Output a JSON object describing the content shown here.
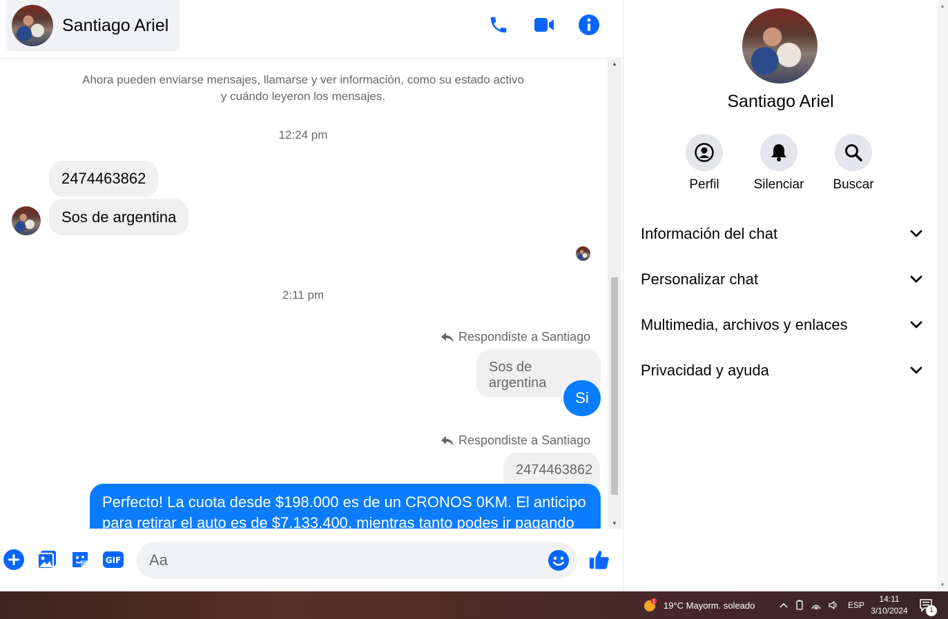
{
  "header": {
    "contact_name": "Santiago Ariel",
    "icons": [
      "phone-icon",
      "video-icon",
      "info-icon"
    ]
  },
  "conversation": {
    "system_note": "Ahora pueden enviarse mensajes, llamarse y ver información, como su estado activo y cuándo leyeron los mensajes.",
    "time_1": "12:24 pm",
    "incoming_1": "2474463862",
    "incoming_2": "Sos de argentina",
    "time_2": "2:11 pm",
    "reply_label_1": "Respondiste a Santiago",
    "quoted_1": "Sos de argentina",
    "outgoing_1": "Si",
    "reply_label_2": "Respondiste a Santiago",
    "quoted_2": "2474463862",
    "outgoing_2": "Perfecto! La cuota desde $198.000 es de un CRONOS 0KM. El anticipo para retirar el auto es de $7.133.400, mientras tanto podes ir pagando"
  },
  "composer": {
    "placeholder": "Aa",
    "value": ""
  },
  "info_panel": {
    "name": "Santiago Ariel",
    "actions": [
      {
        "label": "Perfil",
        "icon": "profile-icon"
      },
      {
        "label": "Silenciar",
        "icon": "bell-icon"
      },
      {
        "label": "Buscar",
        "icon": "search-icon"
      }
    ],
    "sections": [
      {
        "label": "Información del chat"
      },
      {
        "label": "Personalizar chat"
      },
      {
        "label": "Multimedia, archivos y enlaces"
      },
      {
        "label": "Privacidad y ayuda"
      }
    ]
  },
  "taskbar": {
    "weather": "19°C  Mayorm. soleado",
    "language": "ESP",
    "time": "14:11",
    "date": "3/10/2024",
    "notifications_count": "1"
  },
  "colors": {
    "accent": "#0a7cff",
    "icon_blue": "#0866ff",
    "incoming_bubble": "#f0f0f0"
  }
}
